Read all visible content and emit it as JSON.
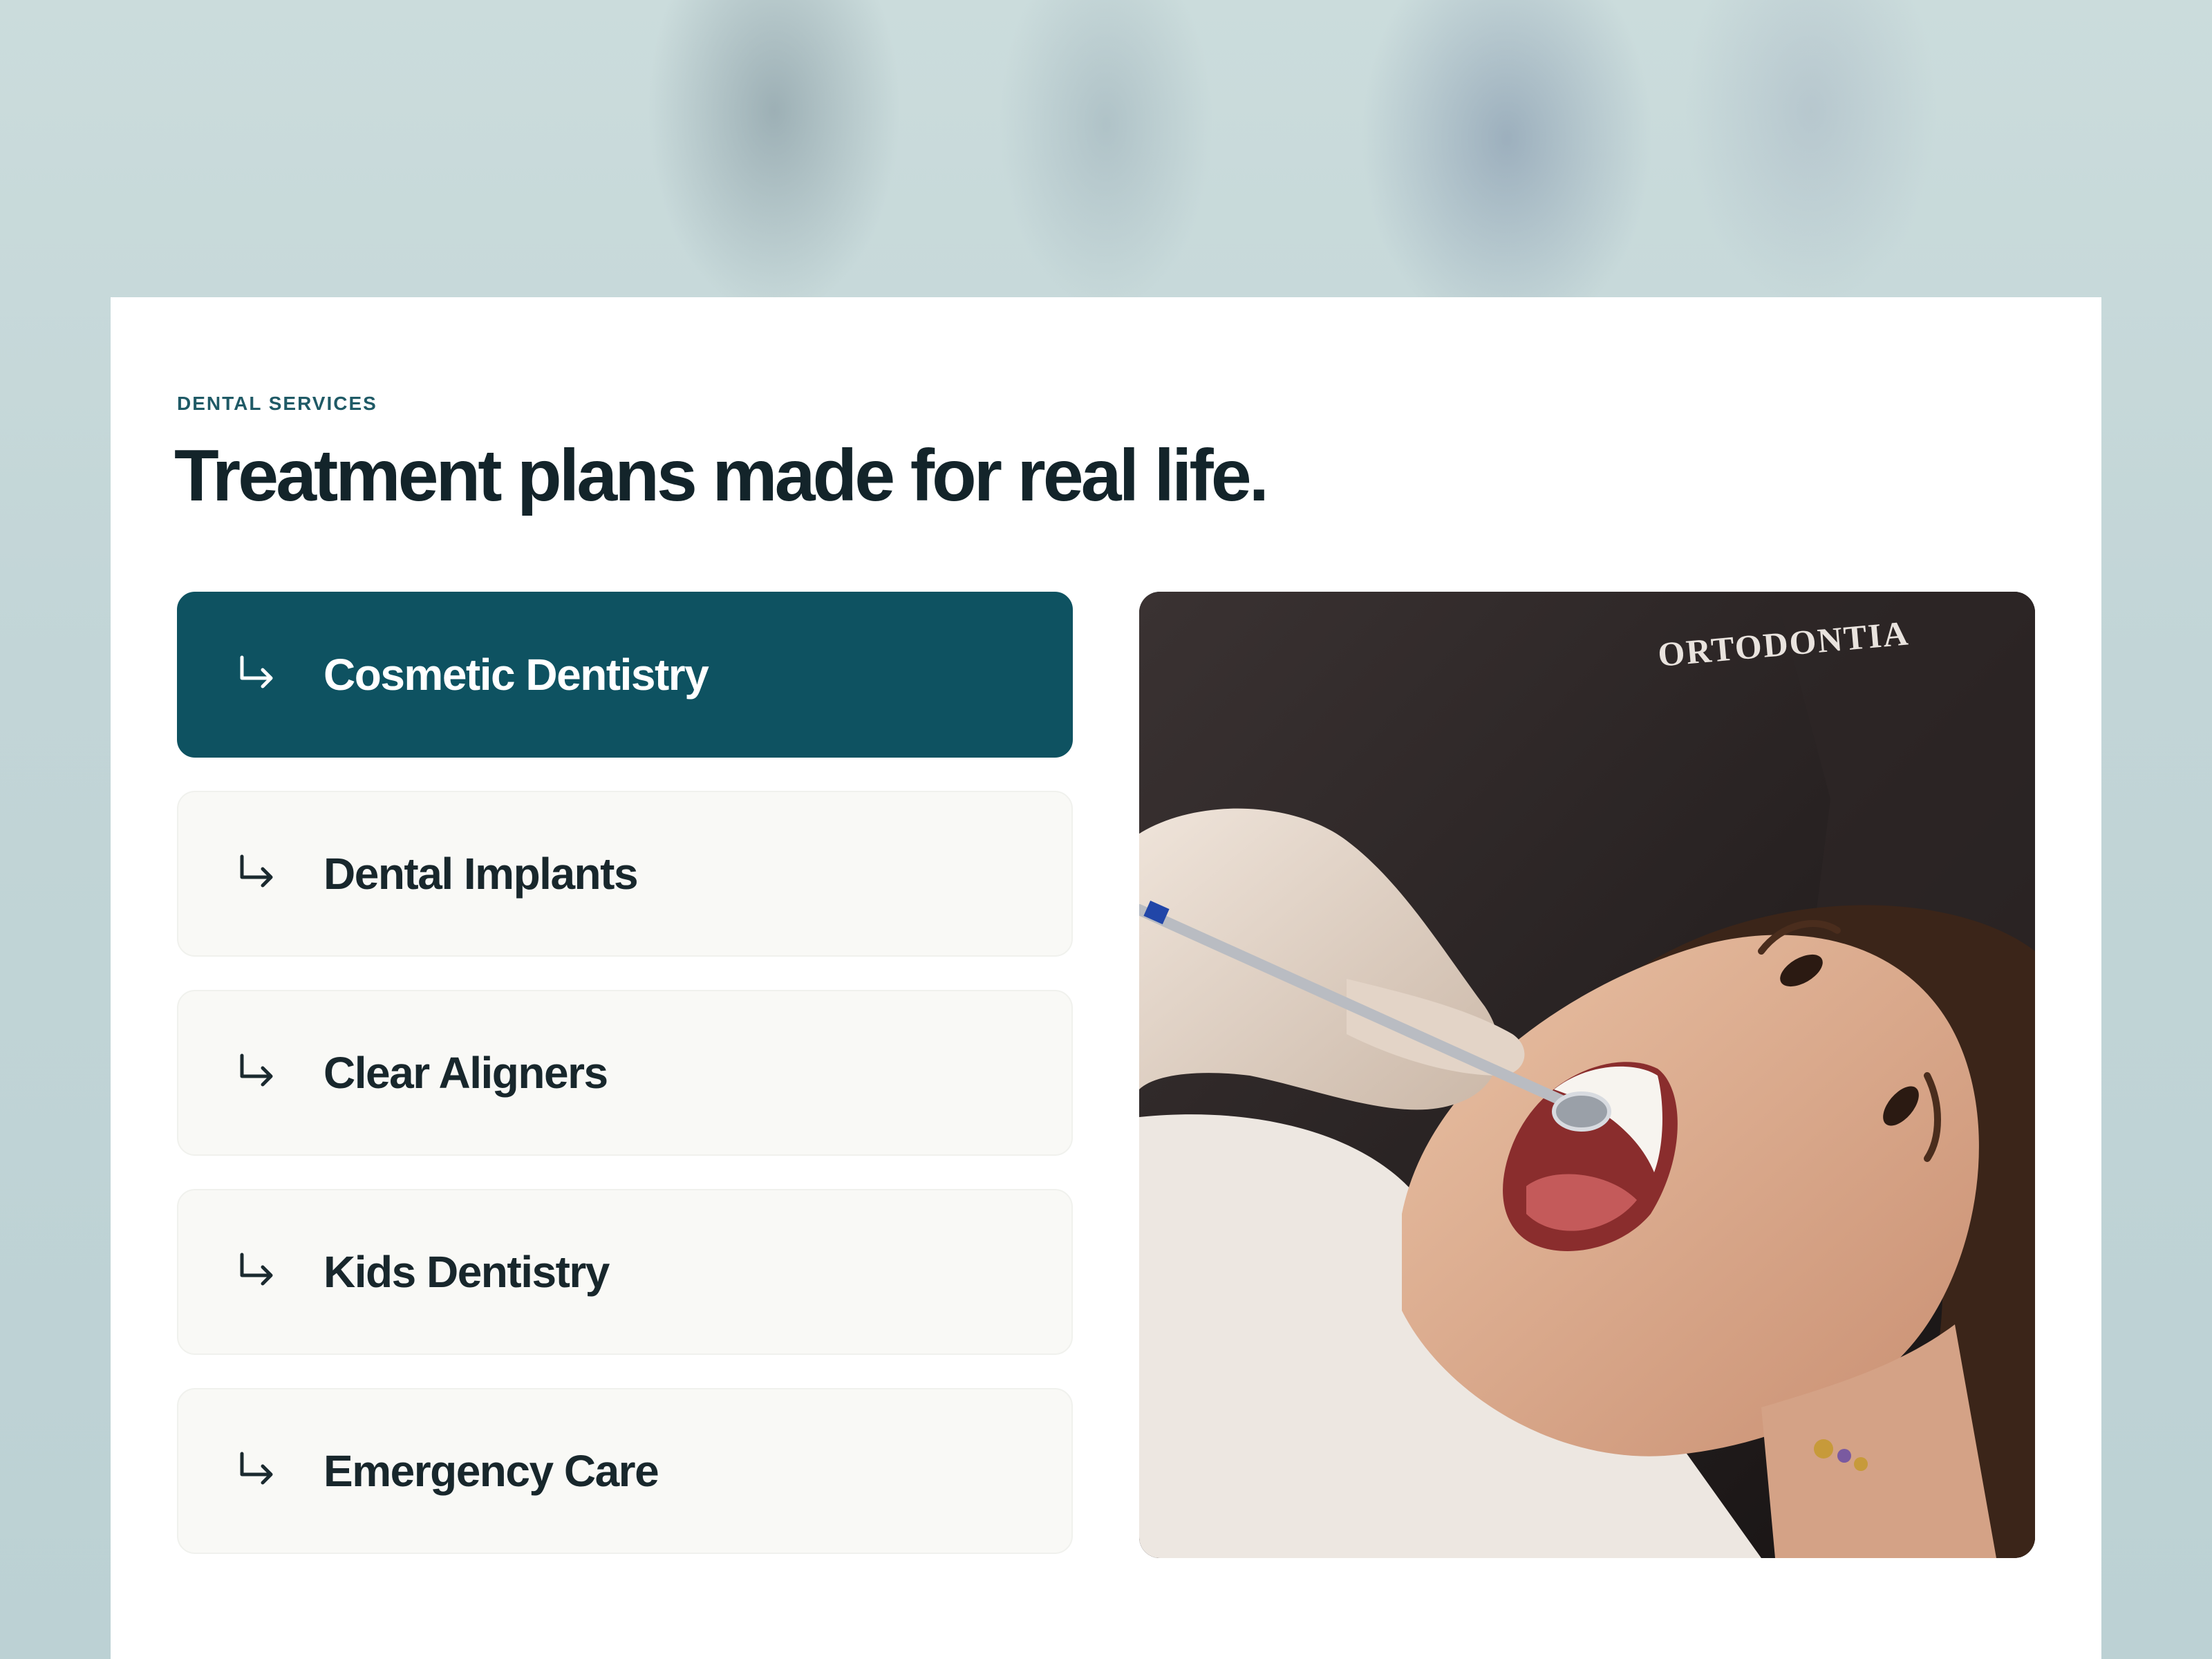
{
  "section": {
    "eyebrow": "DENTAL SERVICES",
    "title": "Treatment plans made for real life."
  },
  "services": [
    {
      "label": "Cosmetic Dentistry",
      "active": true,
      "icon": "arrow-return-right-icon"
    },
    {
      "label": "Dental Implants",
      "active": false,
      "icon": "arrow-return-right-icon"
    },
    {
      "label": "Clear Aligners",
      "active": false,
      "icon": "arrow-return-right-icon"
    },
    {
      "label": "Kids Dentistry",
      "active": false,
      "icon": "arrow-return-right-icon"
    },
    {
      "label": "Emergency Care",
      "active": false,
      "icon": "arrow-return-right-icon"
    }
  ],
  "photo": {
    "uniform_text": "ORTODONTIA"
  },
  "colors": {
    "accent": "#0e5261",
    "heading": "#13242a",
    "eyebrow": "#1f5a66",
    "item_background": "#f9f9f6"
  }
}
